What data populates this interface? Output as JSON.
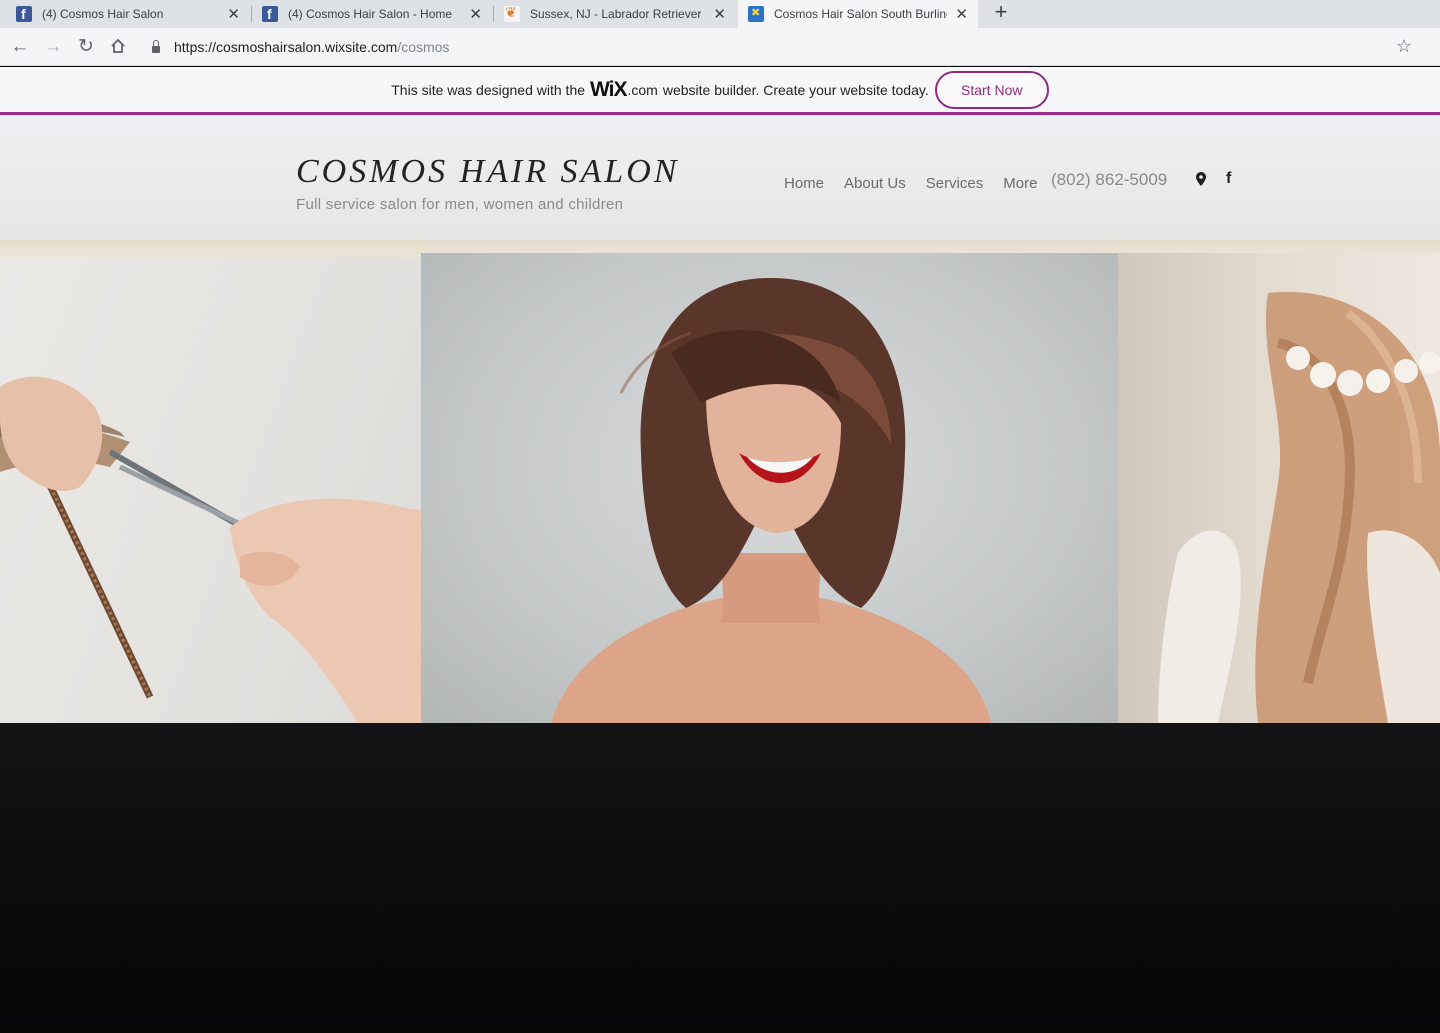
{
  "browser": {
    "tabs": [
      {
        "title": "(4) Cosmos Hair Salon",
        "icon": "facebook-icon",
        "close": "✕"
      },
      {
        "title": "(4) Cosmos Hair Salon - Home",
        "icon": "facebook-icon",
        "close": "✕"
      },
      {
        "title": "Sussex, NJ - Labrador Retriever",
        "icon": "paw-icon",
        "close": "✕"
      },
      {
        "title": "Cosmos Hair Salon South Burling",
        "icon": "wix-x-icon",
        "close": "✕"
      }
    ],
    "new_tab": "+",
    "url_host": "https://cosmoshairsalon.wixsite.com",
    "url_path": "/cosmos"
  },
  "wix_banner": {
    "text_before": "This site was designed with the",
    "logo": "WiX",
    "domain": ".com",
    "text_after": "website builder. Create your website today.",
    "button": "Start Now",
    "accent": "#9c2d8c"
  },
  "site": {
    "title": "COSMOS HAIR SALON",
    "subtitle": "Full service salon for men, women and children",
    "nav": [
      "Home",
      "About Us",
      "Services",
      "More"
    ],
    "phone": "(802) 862-5009",
    "icons": [
      "map-pin-icon",
      "facebook-icon"
    ]
  },
  "gallery": {
    "images": [
      "haircut-scissors-image",
      "laughing-woman-bob-image",
      "flower-crown-hair-image"
    ]
  }
}
